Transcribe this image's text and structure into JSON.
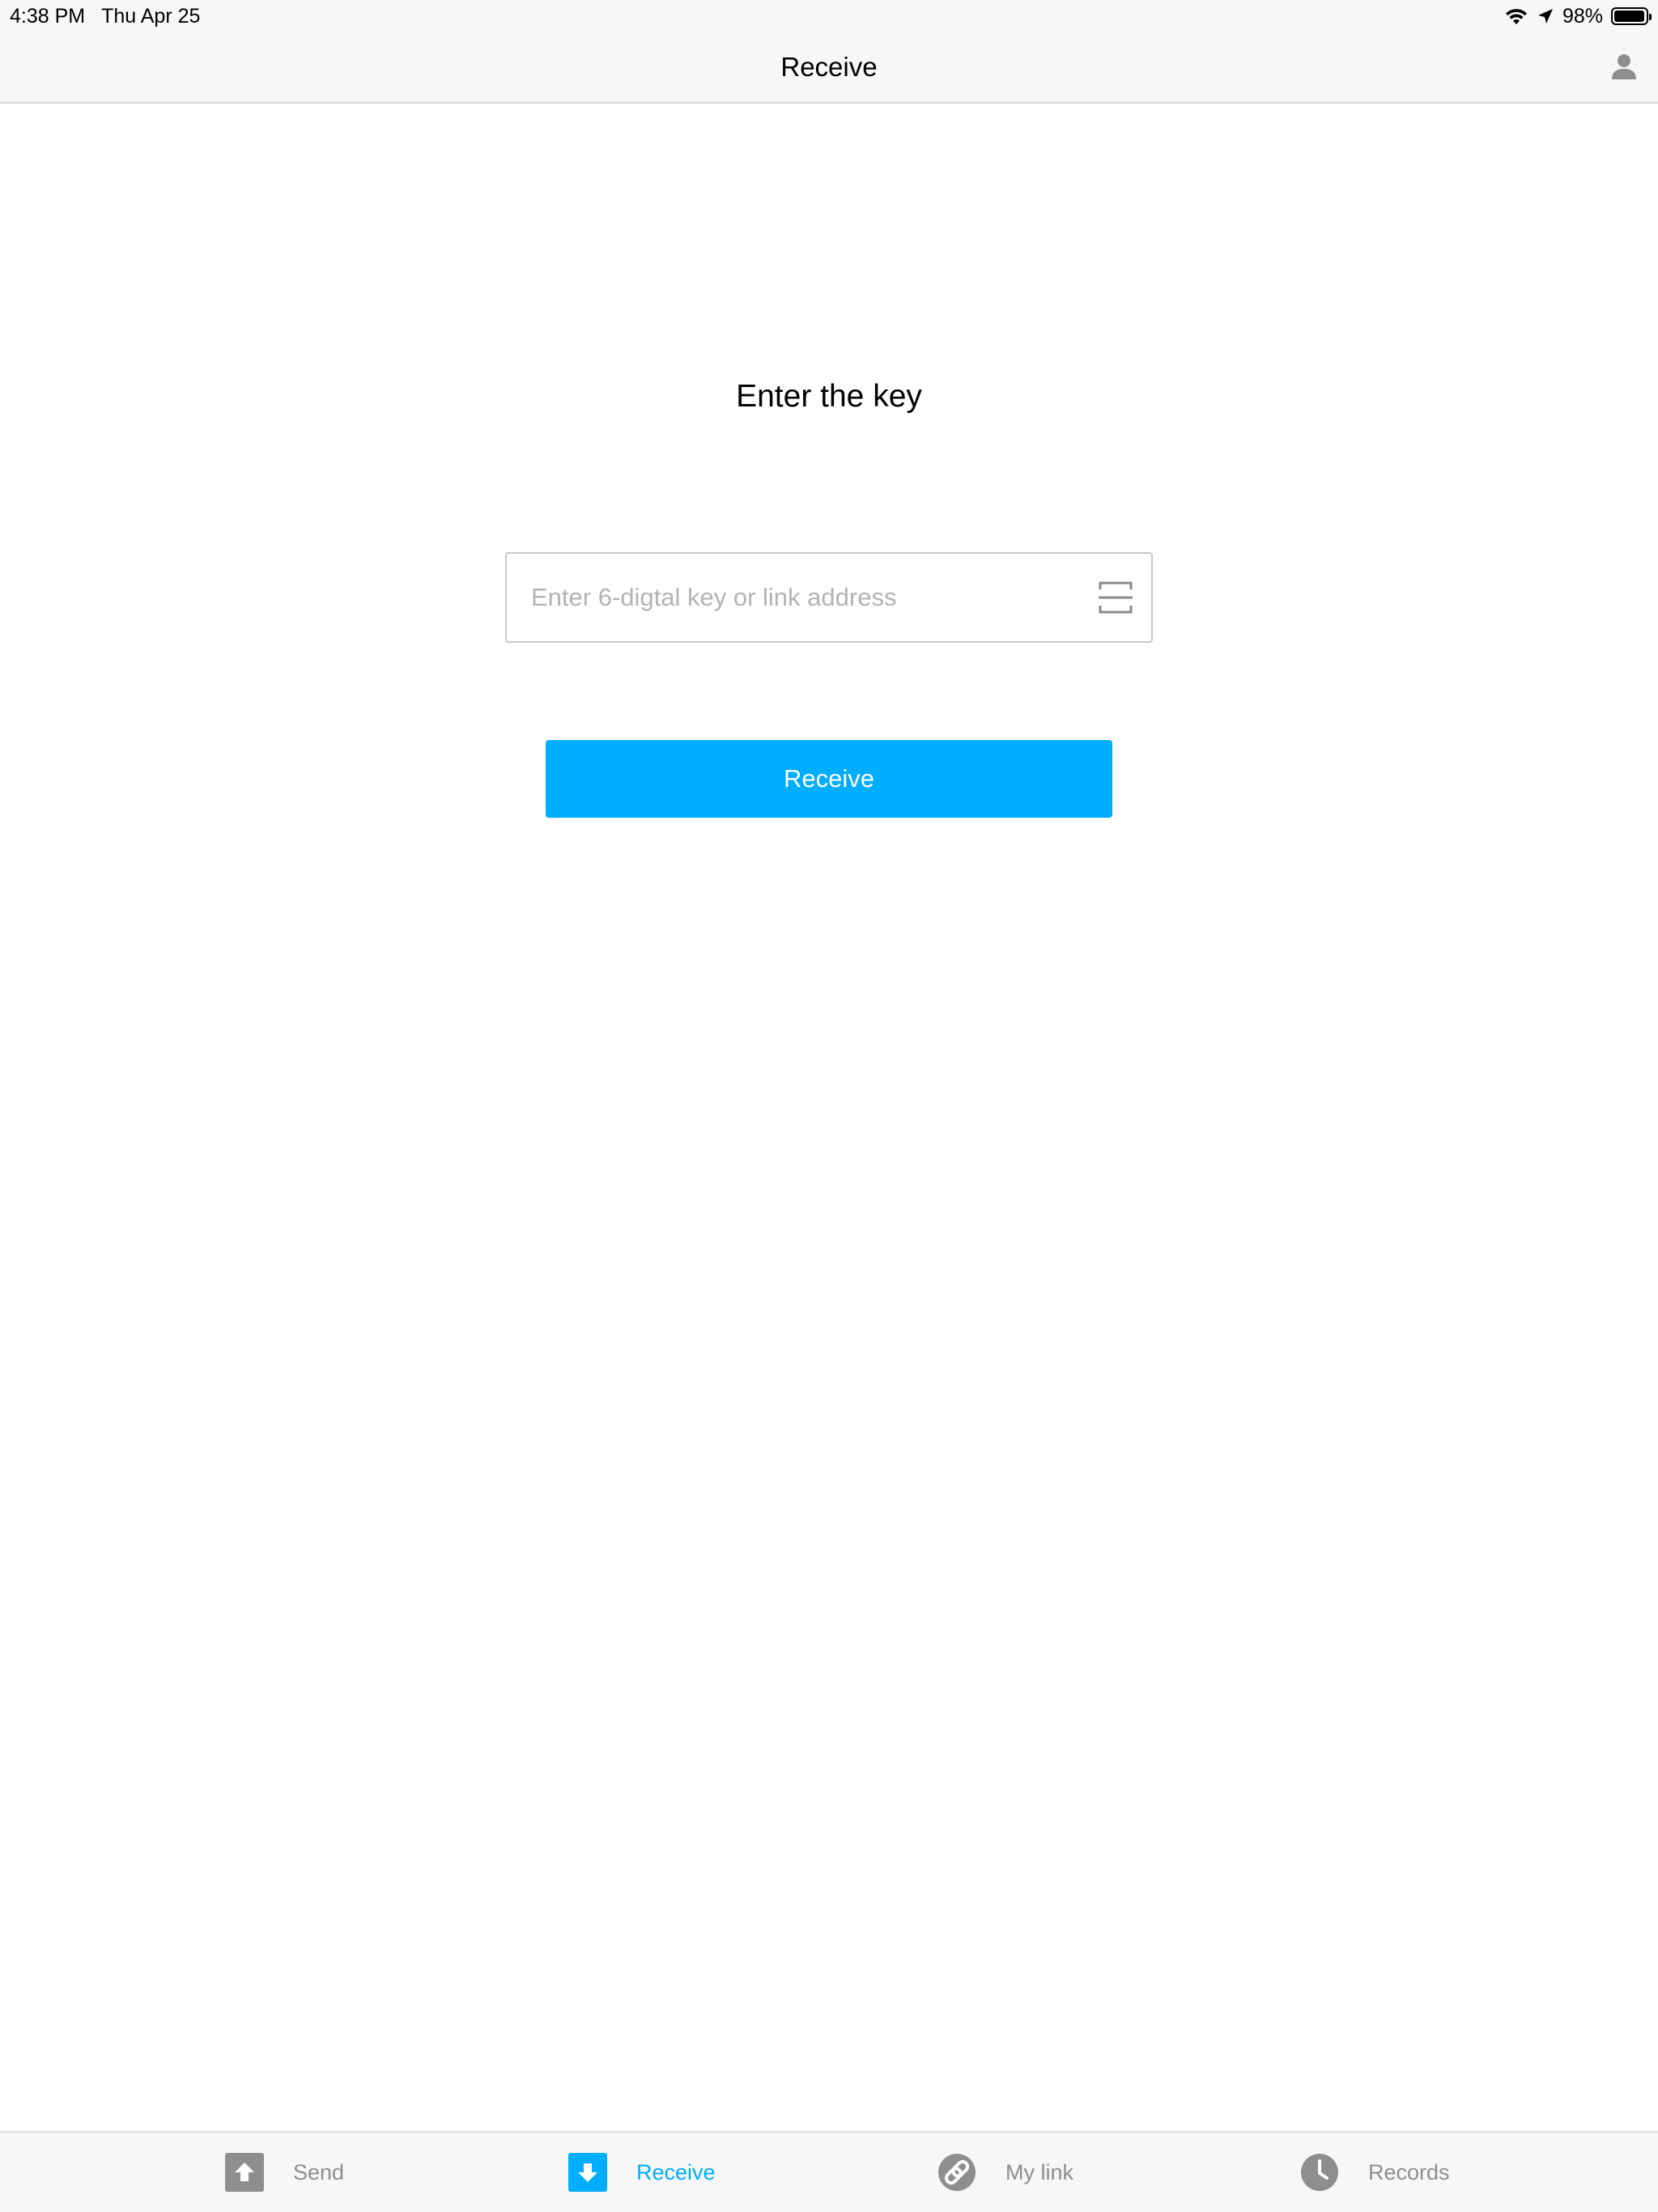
{
  "status_bar": {
    "time": "4:38 PM",
    "date": "Thu Apr 25",
    "battery_percent": "98%",
    "battery_level": 0.98,
    "icons": [
      "wifi-icon",
      "location-arrow-icon",
      "battery-icon"
    ]
  },
  "nav": {
    "title": "Receive",
    "right_icon": "person-icon"
  },
  "main": {
    "heading": "Enter the key",
    "key_input": {
      "value": "",
      "placeholder": "Enter 6-digtal key or link address",
      "trailing_icon": "scan-icon"
    },
    "receive_button_label": "Receive"
  },
  "tab_bar": {
    "active": "Receive",
    "tabs": [
      {
        "label": "Send",
        "icon": "upload-arrow-icon"
      },
      {
        "label": "Receive",
        "icon": "download-arrow-icon"
      },
      {
        "label": "My link",
        "icon": "link-icon"
      },
      {
        "label": "Records",
        "icon": "clock-icon"
      }
    ]
  },
  "colors": {
    "accent": "#00adfe",
    "inactive": "#8e8e8e",
    "bar_background": "#f7f7f7",
    "placeholder": "#b3b3b3"
  }
}
